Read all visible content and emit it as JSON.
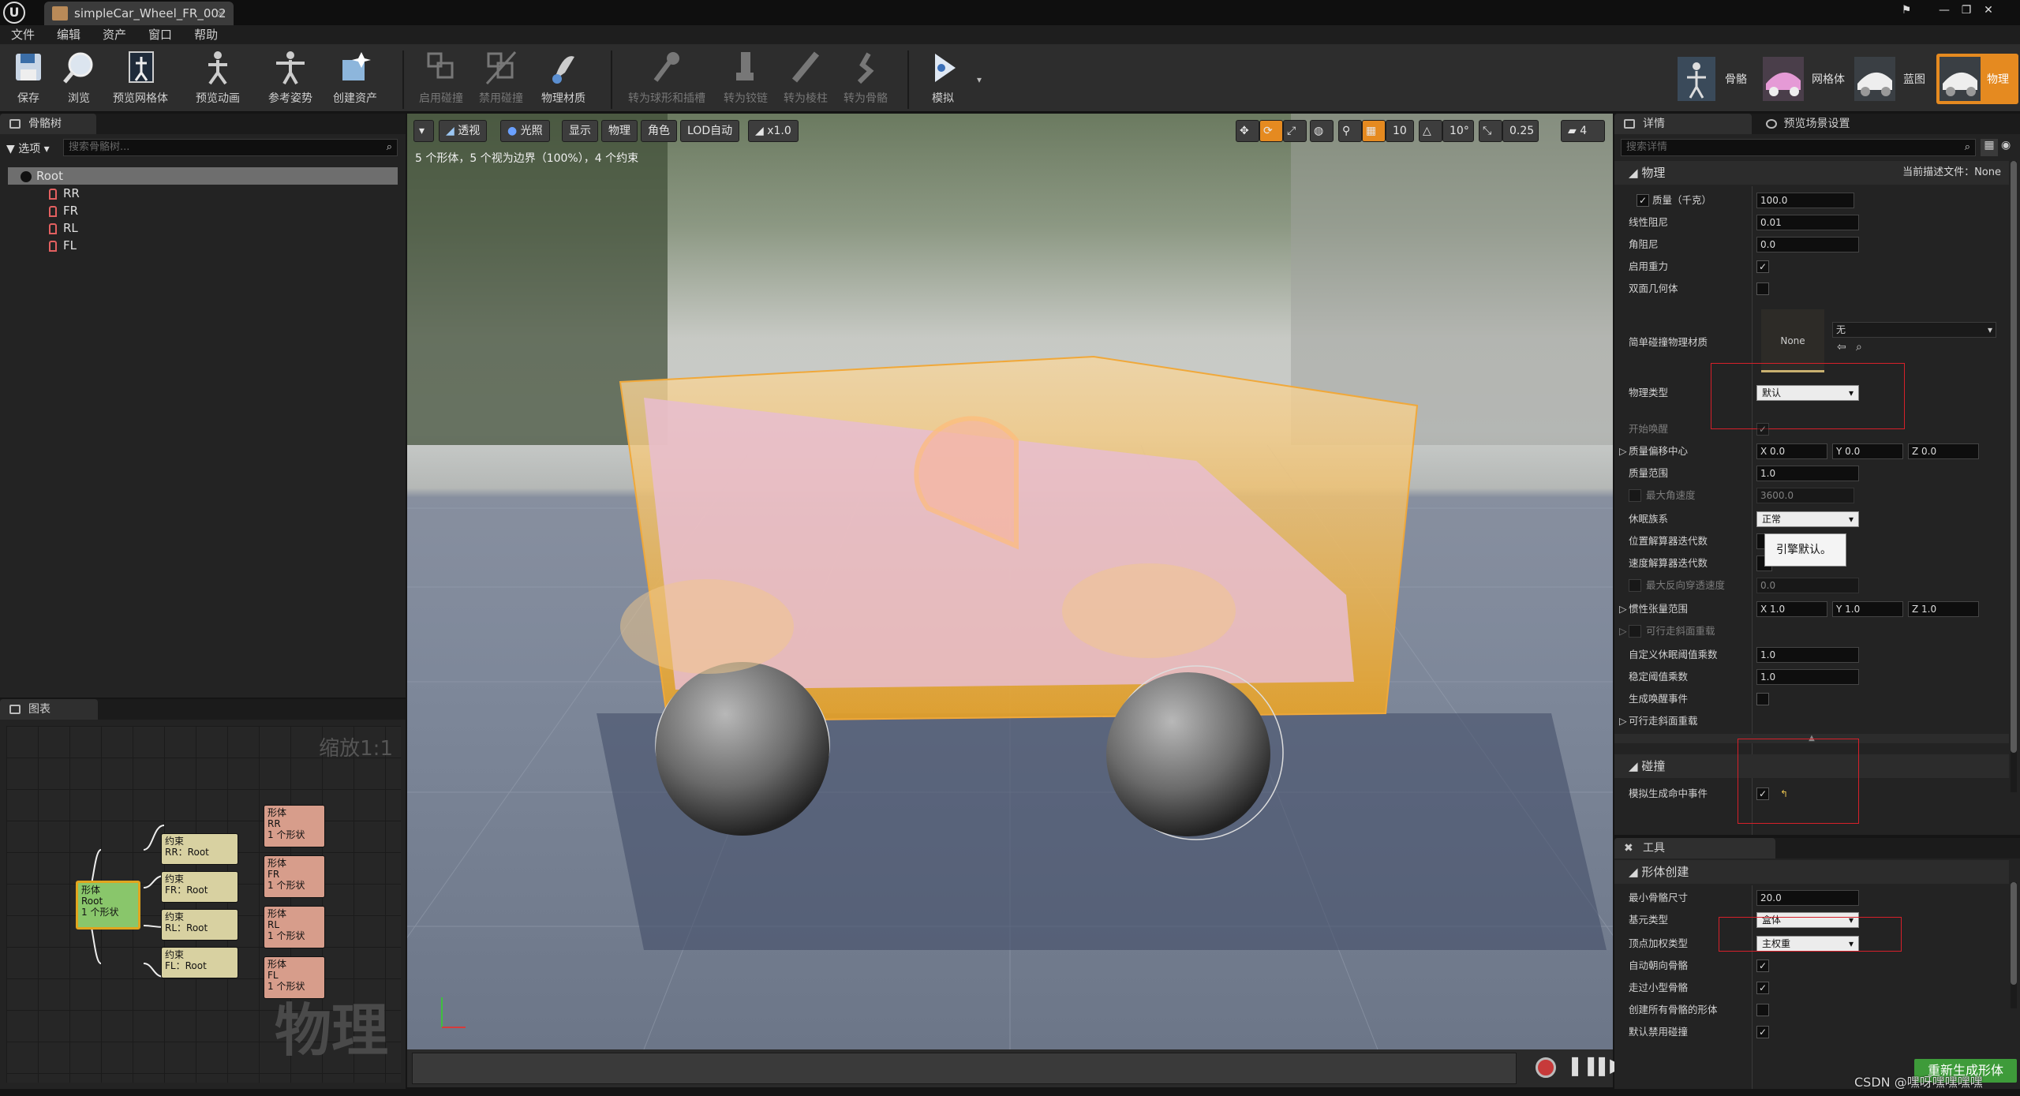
{
  "titlebar": {
    "tab_title": "simpleCar_Wheel_FR_002"
  },
  "menu": [
    "文件",
    "编辑",
    "资产",
    "窗口",
    "帮助"
  ],
  "toolbar": {
    "buttons": [
      {
        "label": "保存",
        "icon": "save-icon"
      },
      {
        "label": "浏览",
        "icon": "browse-icon"
      },
      {
        "label": "预览网格体",
        "icon": "preview-mesh-icon"
      },
      {
        "label": "预览动画",
        "icon": "preview-anim-icon"
      },
      {
        "label": "参考姿势",
        "icon": "ref-pose-icon"
      },
      {
        "label": "创建资产",
        "icon": "create-asset-icon"
      },
      {
        "label": "启用碰撞",
        "icon": "enable-collision-icon"
      },
      {
        "label": "禁用碰撞",
        "icon": "disable-collision-icon"
      },
      {
        "label": "物理材质",
        "icon": "physics-material-icon"
      },
      {
        "label": "转为球形和插槽",
        "icon": "convert-ball-icon"
      },
      {
        "label": "转为铰链",
        "icon": "convert-hinge-icon"
      },
      {
        "label": "转为棱柱",
        "icon": "convert-prismatic-icon"
      },
      {
        "label": "转为骨骼",
        "icon": "convert-skeletal-icon"
      },
      {
        "label": "模拟",
        "icon": "simulate-icon"
      }
    ],
    "modes": [
      "骨骼",
      "网格体",
      "蓝图",
      "物理"
    ]
  },
  "skeleton_panel": {
    "tab": "骨骼树",
    "options": "选项",
    "search_placeholder": "搜索骨骼树...",
    "bones": [
      "Root",
      "RR",
      "FR",
      "RL",
      "FL"
    ]
  },
  "graph_panel": {
    "tab": "图表",
    "zoom": "缩放1:1",
    "watermark": "物理",
    "root_node": [
      "形体",
      "Root",
      "1 个形状"
    ],
    "constraints": [
      [
        "约束",
        "RR：Root"
      ],
      [
        "约束",
        "FR：Root"
      ],
      [
        "约束",
        "RL：Root"
      ],
      [
        "约束",
        "FL：Root"
      ]
    ],
    "bodies": [
      [
        "形体",
        "RR",
        "1 个形状"
      ],
      [
        "形体",
        "FR",
        "1 个形状"
      ],
      [
        "形体",
        "RL",
        "1 个形状"
      ],
      [
        "形体",
        "FL",
        "1 个形状"
      ]
    ]
  },
  "viewport": {
    "buttons": [
      "透视",
      "光照",
      "显示",
      "物理",
      "角色",
      "LOD自动",
      "x1.0"
    ],
    "info": "5 个形体，5 个视为边界（100%），4 个约束",
    "grid_snap": "10",
    "rot_snap": "10°",
    "scale_snap": "0.25",
    "cam_speed": "4"
  },
  "details": {
    "tab": "详情",
    "tab2": "预览场景设置",
    "search_placeholder": "搜索详情",
    "cat_physics": "物理",
    "profile_label": "当前描述文件：None",
    "rows": [
      {
        "k": "质量（千克）",
        "v": "100.0"
      },
      {
        "k": "线性阻尼",
        "v": "0.01"
      },
      {
        "k": "角阻尼",
        "v": "0.0"
      },
      {
        "k": "启用重力"
      },
      {
        "k": "双面几何体"
      },
      {
        "k": "简单碰撞物理材质",
        "thumb": "None",
        "sel": "无"
      },
      {
        "k": "物理类型",
        "v": "默认"
      },
      {
        "k": "开始唤醒"
      },
      {
        "k": "质量偏移中心",
        "x": "0.0",
        "y": "0.0",
        "z": "0.0"
      },
      {
        "k": "质量范围",
        "v": "1.0"
      },
      {
        "k": "最大角速度",
        "v": "3600.0"
      },
      {
        "k": "休眠族系",
        "v": "正常"
      },
      {
        "k": "位置解算器迭代数"
      },
      {
        "k": "速度解算器迭代数"
      },
      {
        "k": "最大反向穿透速度",
        "v": "0.0"
      },
      {
        "k": "惯性张量范围",
        "x": "1.0",
        "y": "1.0",
        "z": "1.0"
      },
      {
        "k": "可行走斜面重载"
      },
      {
        "k": "自定义休眠阈值乘数",
        "v": "1.0"
      },
      {
        "k": "稳定阈值乘数",
        "v": "1.0"
      },
      {
        "k": "生成唤醒事件"
      },
      {
        "k": "可行走斜面重载"
      }
    ],
    "tooltip": "引擎默认。",
    "cat_collision": "碰撞",
    "collision_row": "模拟生成命中事件"
  },
  "tools": {
    "tab": "工具",
    "cat": "形体创建",
    "rows": [
      {
        "k": "最小骨骼尺寸",
        "v": "20.0"
      },
      {
        "k": "基元类型",
        "v": "盒体"
      },
      {
        "k": "顶点加权类型",
        "v": "主权重"
      },
      {
        "k": "自动朝向骨骼"
      },
      {
        "k": "走过小型骨骼"
      },
      {
        "k": "创建所有骨骼的形体"
      },
      {
        "k": "默认禁用碰撞"
      }
    ],
    "regen_button": "重新生成形体"
  },
  "watermark": "CSDN @嘿呀嘿嘿嘿嘿"
}
